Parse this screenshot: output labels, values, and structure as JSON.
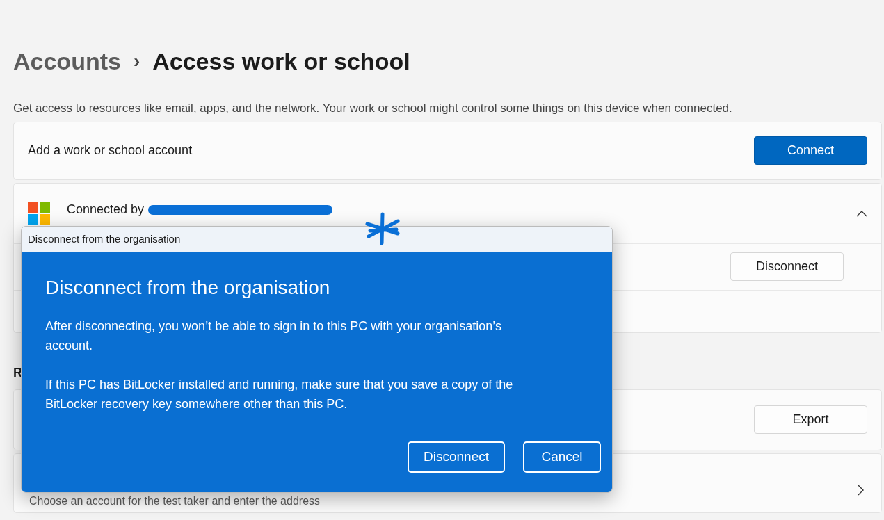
{
  "breadcrumb": {
    "parent": "Accounts",
    "separator": "›",
    "current": "Access work or school"
  },
  "description": "Get access to resources like email, apps, and the network. Your work or school might control some things on this device when connected.",
  "add_account": {
    "label": "Add a work or school account",
    "button": "Connect"
  },
  "connection": {
    "title": "Connected by",
    "expanded": true,
    "disconnect_button": "Disconnect"
  },
  "section_heading": "R",
  "export_row": {
    "button": "Export"
  },
  "test_row": {
    "subtitle": "Choose an account for the test taker and enter the address"
  },
  "dialog": {
    "title_bar": "Disconnect from the organisation",
    "heading": "Disconnect from the organisation",
    "paragraphs": [
      "After disconnecting, you won’t be able to sign in to this PC with your organisation’s account.",
      "If this PC has BitLocker installed and running, make sure that you save a copy of the BitLocker recovery key somewhere other than this PC."
    ],
    "buttons": [
      "Disconnect",
      "Cancel"
    ]
  }
}
